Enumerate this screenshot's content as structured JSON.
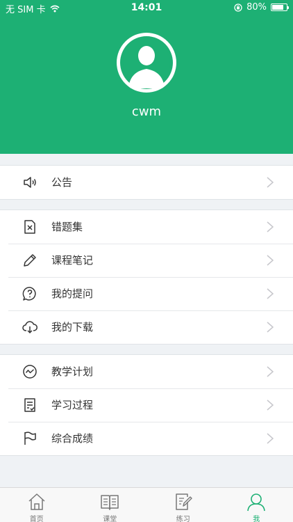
{
  "status_bar": {
    "carrier": "无 SIM 卡",
    "time": "14:01",
    "battery_percent": "80%",
    "battery_level": 0.8
  },
  "profile": {
    "username": "cwm",
    "avatar_icon": "user-silhouette-icon"
  },
  "colors": {
    "brand": "#1db074",
    "background": "#eff2f5",
    "text": "#333333"
  },
  "menu": {
    "group1": [
      {
        "label": "公告",
        "icon": "speaker-icon"
      }
    ],
    "group2": [
      {
        "label": "错题集",
        "icon": "wrong-answers-icon"
      },
      {
        "label": "课程笔记",
        "icon": "pencil-icon"
      },
      {
        "label": "我的提问",
        "icon": "question-bubble-icon"
      },
      {
        "label": "我的下载",
        "icon": "cloud-download-icon"
      }
    ],
    "group3": [
      {
        "label": "教学计划",
        "icon": "plan-icon"
      },
      {
        "label": "学习过程",
        "icon": "checklist-icon"
      },
      {
        "label": "综合成绩",
        "icon": "flag-icon"
      }
    ]
  },
  "tabs": [
    {
      "label": "首页",
      "icon": "home-icon",
      "active": false
    },
    {
      "label": "课堂",
      "icon": "book-icon",
      "active": false
    },
    {
      "label": "练习",
      "icon": "exercise-icon",
      "active": false
    },
    {
      "label": "我",
      "icon": "person-icon",
      "active": true
    }
  ]
}
